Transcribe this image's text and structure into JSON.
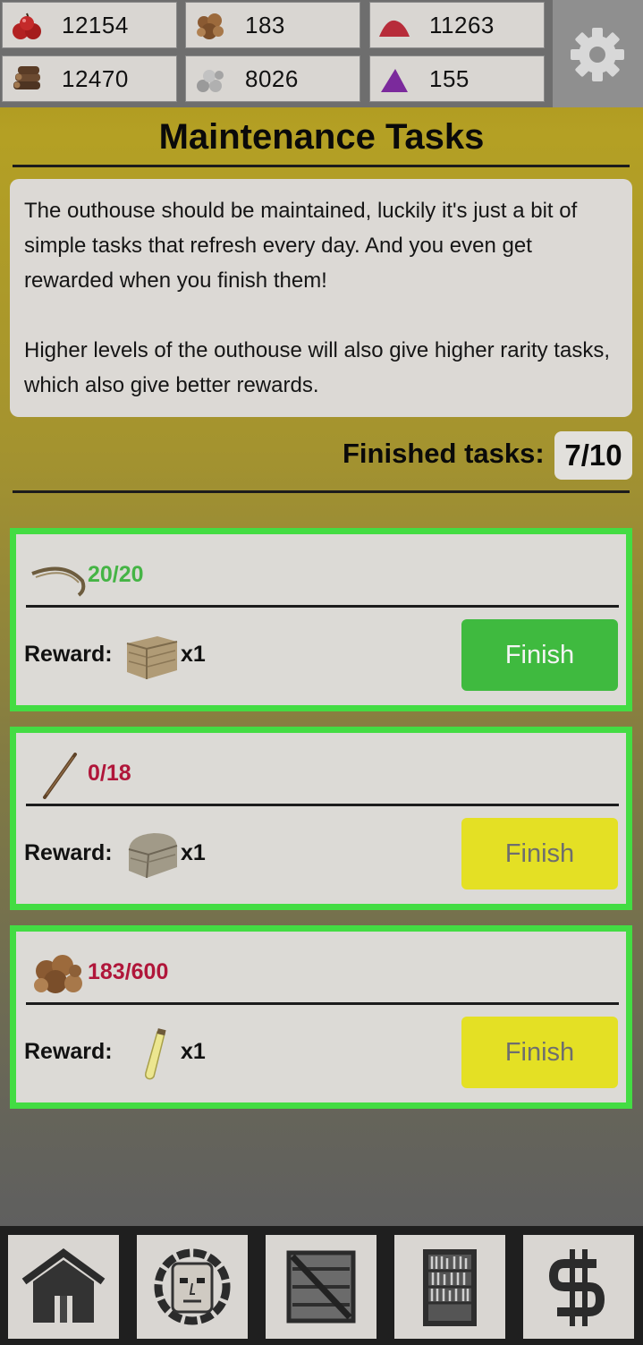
{
  "resources": [
    {
      "icon": "berries-icon",
      "value": "12154"
    },
    {
      "icon": "bush-icon",
      "value": "183"
    },
    {
      "icon": "red-powder-icon",
      "value": "11263"
    },
    {
      "icon": "logs-icon",
      "value": "12470"
    },
    {
      "icon": "stones-icon",
      "value": "8026"
    },
    {
      "icon": "purple-powder-icon",
      "value": "155"
    }
  ],
  "settings_icon": "gear-icon",
  "page": {
    "title": "Maintenance Tasks",
    "description_1": "The outhouse should be maintained, luckily it's just a bit of simple tasks that refresh every day. And you even get rewarded when you finish them!",
    "description_2": "Higher levels of the outhouse will also give higher rarity tasks, which also give better rewards.",
    "finished_label": "Finished tasks:",
    "finished_count": "7/10"
  },
  "tasks": [
    {
      "icon": "rope-icon",
      "progress": "20/20",
      "progress_color": "#45b445",
      "reward_label": "Reward:",
      "reward_icon": "crate-icon",
      "reward_qty": "x1",
      "button": "Finish",
      "button_state": "ready"
    },
    {
      "icon": "stick-icon",
      "progress": "0/18",
      "progress_color": "#b0163a",
      "reward_label": "Reward:",
      "reward_icon": "chest-icon",
      "reward_qty": "x1",
      "button": "Finish",
      "button_state": "incomplete"
    },
    {
      "icon": "bush-icon",
      "progress": "183/600",
      "progress_color": "#b0163a",
      "reward_label": "Reward:",
      "reward_icon": "vial-icon",
      "reward_qty": "x1",
      "button": "Finish",
      "button_state": "incomplete"
    }
  ],
  "nav": [
    "house-icon",
    "character-icon",
    "crate-icon",
    "bookshelf-icon",
    "dollar-icon"
  ]
}
